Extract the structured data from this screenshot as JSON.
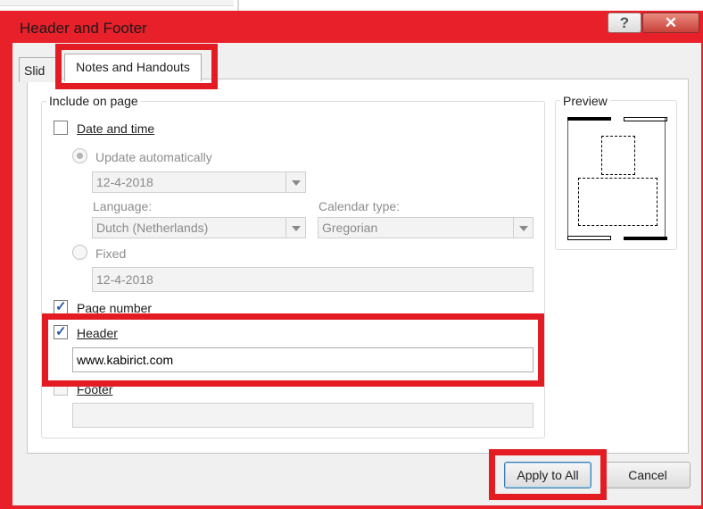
{
  "window": {
    "title": "Header and Footer",
    "help_label": "?",
    "close_label": "✕"
  },
  "tabs": [
    {
      "label": "Slid",
      "active": false
    },
    {
      "label": "Notes and Handouts",
      "active": true
    }
  ],
  "include_group": {
    "label": "Include on page",
    "date_time": {
      "label": "Date and time",
      "checked": false
    },
    "update_auto": {
      "label": "Update automatically",
      "selected": true
    },
    "date_combo": {
      "value": "12-4-2018"
    },
    "language": {
      "label": "Language:",
      "value": "Dutch (Netherlands)"
    },
    "calendar": {
      "label": "Calendar type:",
      "value": "Gregorian"
    },
    "fixed": {
      "label": "Fixed",
      "value": "12-4-2018",
      "selected": false
    },
    "page_number": {
      "label": "Page number",
      "checked": true
    },
    "header": {
      "label": "Header",
      "checked": true,
      "value": "www.kabirict.com"
    },
    "footer": {
      "label": "Footer",
      "checked": false,
      "value": ""
    }
  },
  "preview": {
    "label": "Preview"
  },
  "buttons": {
    "apply_all": "Apply to All",
    "cancel": "Cancel"
  },
  "colors": {
    "frame": "#e8202a",
    "highlight": "#e31b23",
    "check": "#2a5aa5"
  }
}
